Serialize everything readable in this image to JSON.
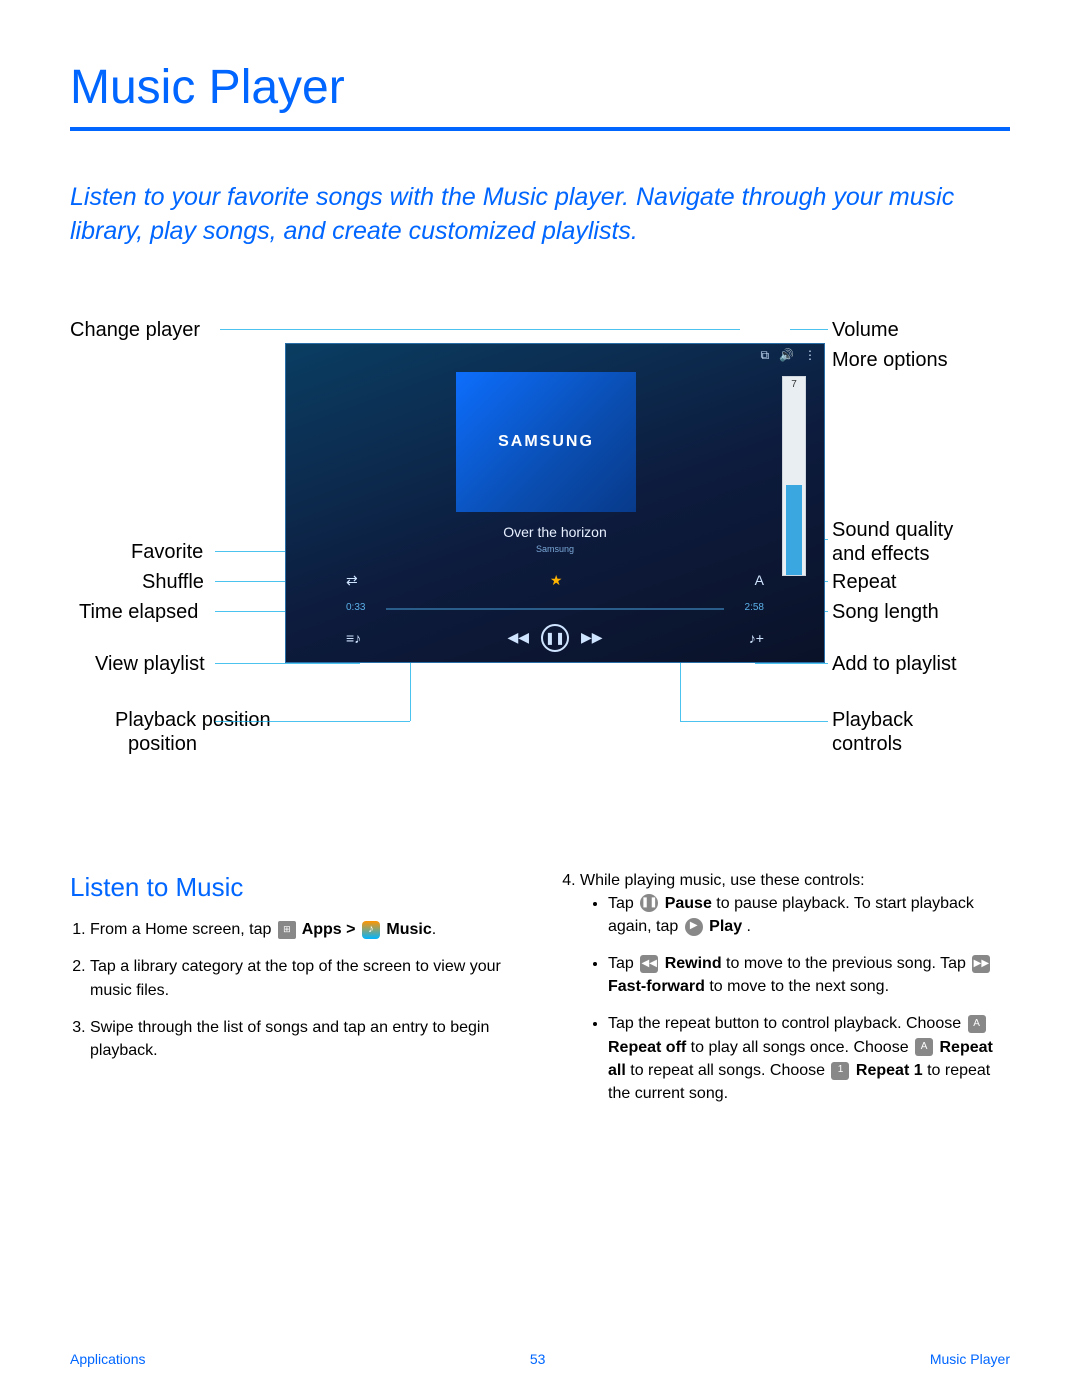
{
  "title": "Music Player",
  "intro": "Listen to your favorite songs with the Music player. Navigate through your music library, play songs, and create customized playlists.",
  "player": {
    "brand": "SAMSUNG",
    "song_title": "Over the horizon",
    "song_artist": "Samsung",
    "volume_level": "7",
    "time_elapsed": "0:33",
    "time_total": "2:58",
    "icons": {
      "shuffle": "⇄",
      "favorite": "★",
      "repeat": "A",
      "viewplaylist": "≡♪",
      "rewind": "◀◀",
      "pause": "❚❚",
      "forward": "▶▶",
      "addplaylist": "♪+",
      "changeplayer": "⧉",
      "volume": "🔊",
      "more": "⋮"
    }
  },
  "callouts": {
    "change_player": "Change player",
    "favorite": "Favorite",
    "shuffle": "Shuffle",
    "time_elapsed": "Time elapsed",
    "view_playlist": "View playlist",
    "playback_position": "Playback position",
    "playback_position2": "position",
    "volume": "Volume",
    "more_options": "More options",
    "sound_quality": "Sound quality",
    "sound_quality2": "and effects",
    "repeat": "Repeat",
    "song_length": "Song length",
    "add_to_playlist": "Add to playlist",
    "playback_controls": "Playback",
    "playback_controls2": "controls"
  },
  "section_heading": "Listen to Music",
  "steps_left": {
    "s1a": "From a Home screen, tap ",
    "s1b": " Apps > ",
    "s1c": " Music",
    "s1d": ".",
    "s2": "Tap a library category at the top of the screen to view your music files.",
    "s3": "Swipe through the list of songs and tap an entry to begin playback."
  },
  "steps_right": {
    "s4": "While playing music, use these controls:",
    "b1a": "Tap ",
    "b1b": " Pause",
    "b1c": " to pause playback. To start playback again, tap ",
    "b1d": " Play",
    "b1e": " .",
    "b2a": "Tap ",
    "b2b": " Rewind",
    "b2c": " to move to the previous song. Tap ",
    "b2d": " Fast-forward",
    "b2e": " to move to the next song.",
    "b3a": "Tap the repeat button to control playback. Choose ",
    "b3b": " Repeat off",
    "b3c": " to play all songs once. Choose ",
    "b3d": " Repeat all",
    "b3e": " to repeat all songs. Choose ",
    "b3f": " Repeat 1",
    "b3g": " to repeat the current song."
  },
  "footer": {
    "left": "Applications",
    "center": "53",
    "right": "Music Player"
  }
}
